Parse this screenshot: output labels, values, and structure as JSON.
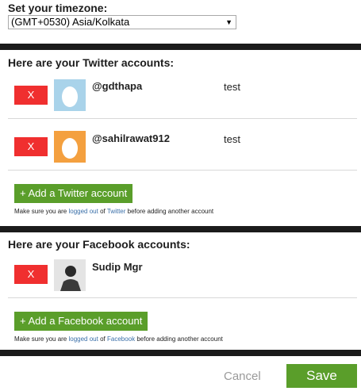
{
  "timezone": {
    "heading": "Set your timezone:",
    "selected": "(GMT+0530) Asia/Kolkata"
  },
  "twitter": {
    "heading": "Here are your Twitter accounts:",
    "accounts": [
      {
        "delete_label": "X",
        "handle": "@gdthapa",
        "label": "test",
        "avatar_color": "#a9d3ea",
        "avatar_icon": "egg-avatar-icon"
      },
      {
        "delete_label": "X",
        "handle": "@sahilrawat912",
        "label": "test",
        "avatar_color": "#f4a03f",
        "avatar_icon": "egg-avatar-icon"
      }
    ],
    "add_label": "+ Add a Twitter account",
    "note": {
      "pre": "Make sure you are ",
      "link1": "logged out",
      "mid": " of ",
      "link2": "Twitter",
      "post": " before adding another account"
    }
  },
  "facebook": {
    "heading": "Here are your Facebook accounts:",
    "accounts": [
      {
        "delete_label": "X",
        "name": "Sudip Mgr",
        "avatar_icon": "profile-photo"
      }
    ],
    "add_label": "+ Add a Facebook account",
    "note": {
      "pre": "Make sure you are ",
      "link1": "logged out",
      "mid": " of ",
      "link2": "Facebook",
      "post": " before adding another account"
    }
  },
  "footer": {
    "cancel_label": "Cancel",
    "save_label": "Save"
  },
  "colors": {
    "delete": "#f02f2f",
    "primary": "#5a9e2a",
    "divider": "#1b1b1b",
    "link": "#3a6fa8"
  }
}
